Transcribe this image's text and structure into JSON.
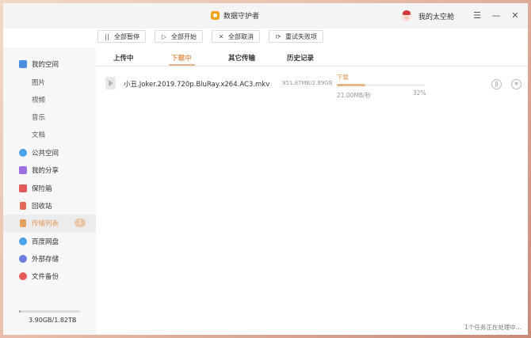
{
  "window": {
    "app_title": "数据守护者",
    "user_name": "我的太空舱",
    "controls": {
      "menu": "☰",
      "minimize": "—",
      "close": "✕"
    }
  },
  "toolbar": {
    "pause_all": {
      "icon": "pause-icon",
      "glyph": "||",
      "label": "全部暂停"
    },
    "start_all": {
      "icon": "play-icon",
      "glyph": "▷",
      "label": "全部开始"
    },
    "cancel_all": {
      "icon": "close-icon",
      "glyph": "✕",
      "label": "全部取消"
    },
    "retry_failed": {
      "icon": "refresh-icon",
      "glyph": "⟳",
      "label": "重试失败项"
    }
  },
  "sidebar": {
    "items": [
      {
        "label": "我的空间",
        "icon": "folder-icon",
        "color": "#4a8fe0"
      },
      {
        "label": "图片"
      },
      {
        "label": "视频"
      },
      {
        "label": "音乐"
      },
      {
        "label": "文档"
      },
      {
        "label": "公共空间",
        "icon": "send-icon",
        "color": "#4aa3e8"
      },
      {
        "label": "我的分享",
        "icon": "share-icon",
        "color": "#9b6fe0"
      },
      {
        "label": "保险箱",
        "icon": "safe-icon",
        "color": "#e05a5a"
      },
      {
        "label": "回收站",
        "icon": "trash-icon",
        "color": "#e86a5a"
      },
      {
        "label": "传输列表",
        "icon": "transfer-icon",
        "color": "#e6a060",
        "badge": "1"
      },
      {
        "label": "百度网盘",
        "icon": "cloud-icon",
        "color": "#4aa3e8"
      },
      {
        "label": "外部存储",
        "icon": "usb-icon",
        "color": "#6a7fe0"
      },
      {
        "label": "文件备份",
        "icon": "backup-icon",
        "color": "#e65a5a"
      }
    ],
    "storage": {
      "text": "3.90GB/1.82TB",
      "used_fraction": 0.02
    }
  },
  "tabs": [
    {
      "label": "上传中"
    },
    {
      "label": "下载中"
    },
    {
      "label": "其它传输"
    },
    {
      "label": "历史记录"
    }
  ],
  "transfers": [
    {
      "file_icon": "video-file-icon",
      "name": "小丑.Joker.2019.720p.BluRay.x264.AC3.mkv",
      "size": "951.87MB/2.89GB",
      "status": "下载",
      "progress": 0.32,
      "speed": "21.00MB/秒",
      "percent": "32%",
      "actions": {
        "pause": "||",
        "cancel": "✕"
      }
    }
  ],
  "footer": {
    "status": "1个任务正在处理中..."
  }
}
